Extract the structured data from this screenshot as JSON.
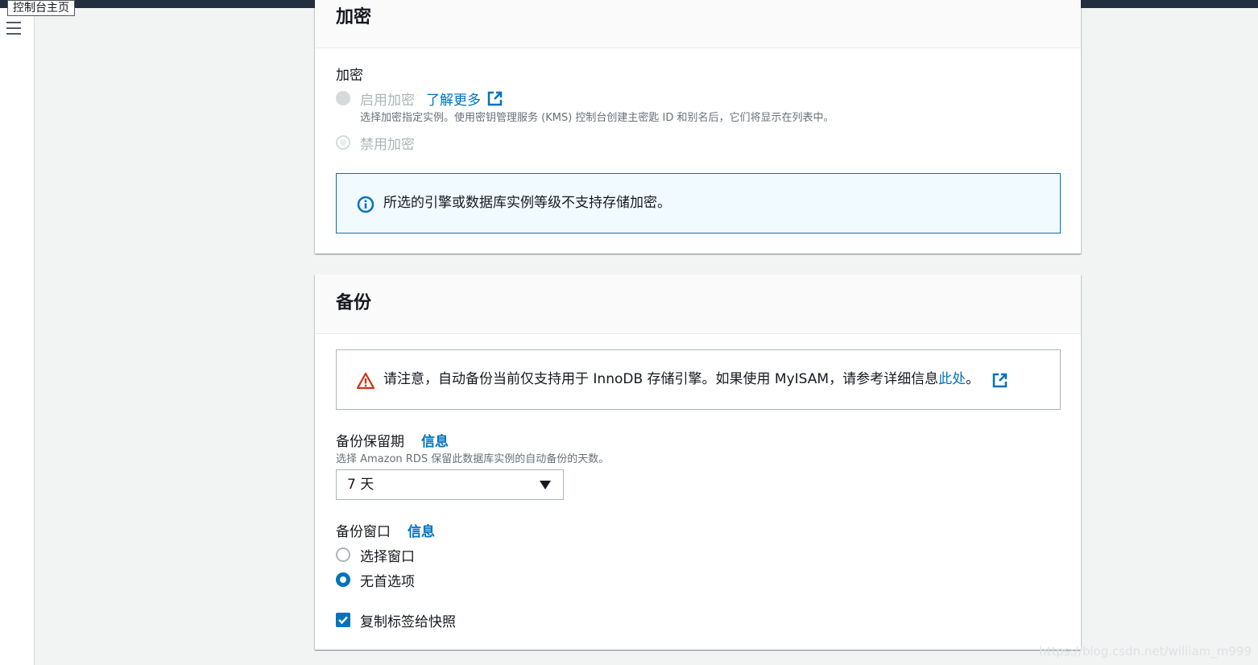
{
  "tooltip": "控制台主页",
  "encryption": {
    "title": "加密",
    "field_label": "加密",
    "enable_label": "启用加密",
    "learn_more": "了解更多",
    "enable_desc": "选择加密指定实例。使用密钥管理服务 (KMS) 控制台创建主密匙 ID 和别名后，它们将显示在列表中。",
    "disable_label": "禁用加密",
    "info_alert": "所选的引擎或数据库实例等级不支持存储加密。"
  },
  "backup": {
    "title": "备份",
    "warning_text": "请注意，自动备份当前仅支持用于 InnoDB 存储引擎。如果使用 MyISAM，请参考详细信息",
    "warning_link": "此处",
    "warning_end": "。",
    "retention_label": "备份保留期",
    "retention_info": "信息",
    "retention_desc": "选择 Amazon RDS 保留此数据库实例的自动备份的天数。",
    "retention_value": "7 天",
    "window_label": "备份窗口",
    "window_info": "信息",
    "window_option_select": "选择窗口",
    "window_option_none": "无首选项",
    "copy_tags_label": "复制标签给快照",
    "copy_tags_checked": true
  },
  "watermark": "https://blog.csdn.net/william_m999",
  "colors": {
    "accent": "#0073bb",
    "topbar": "#232f3e",
    "warning": "#d13212"
  }
}
